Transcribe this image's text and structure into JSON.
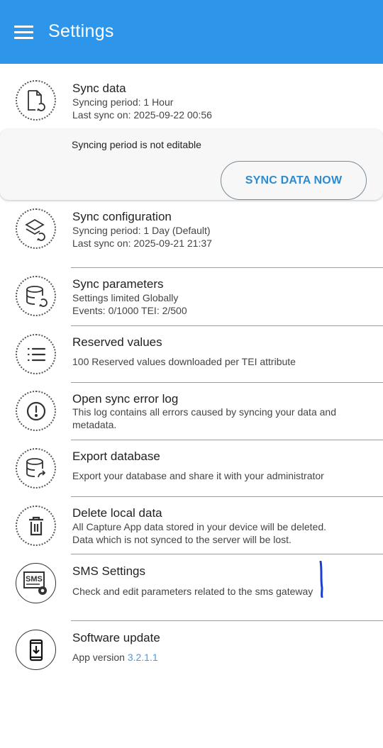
{
  "appbar": {
    "title": "Settings"
  },
  "sync_data": {
    "title": "Sync data",
    "period": "Syncing period: 1 Hour",
    "last_sync": "Last sync on: 2025-09-22 00:56",
    "note": "Syncing period is not editable",
    "button": "SYNC DATA NOW"
  },
  "sync_config": {
    "title": "Sync configuration",
    "period": "Syncing period: 1 Day (Default)",
    "last_sync": "Last sync on: 2025-09-21 21:37"
  },
  "sync_params": {
    "title": "Sync parameters",
    "line1": "Settings limited Globally",
    "line2": "Events: 0/1000 TEI: 2/500"
  },
  "reserved": {
    "title": "Reserved values",
    "line1": "100 Reserved values downloaded per TEI attribute"
  },
  "error_log": {
    "title": "Open sync error log",
    "line1": "This log contains all errors caused by syncing your data and",
    "line2": "metadata."
  },
  "export_db": {
    "title": "Export database",
    "line1": "Export your database and share it with your administrator"
  },
  "delete_local": {
    "title": "Delete local data",
    "line1": "All Capture App data stored in your device will be deleted.",
    "line2": "Data which is not synced to the server will be lost."
  },
  "sms": {
    "title": "SMS Settings",
    "line1": "Check and edit parameters related to the sms gateway",
    "icon_text": "SMS"
  },
  "software": {
    "title": "Software update",
    "label": "App version",
    "version": "3.2.1.1"
  },
  "colors": {
    "appbar": "#2d96ea",
    "accent": "#2d8bd0",
    "link": "#4a9be0"
  }
}
